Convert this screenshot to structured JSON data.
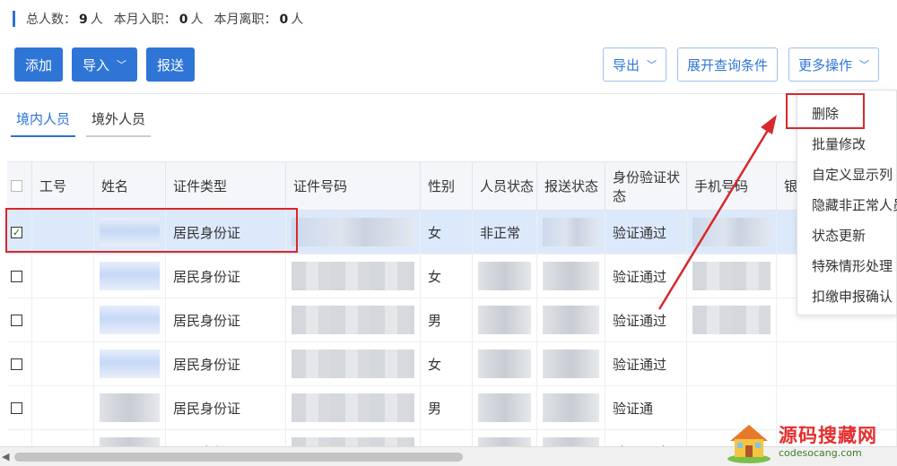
{
  "summary": {
    "total_label": "总人数：",
    "total_value": "9",
    "total_unit": "人",
    "joined_label": "本月入职：",
    "joined_value": "0",
    "joined_unit": "人",
    "left_label": "本月离职：",
    "left_value": "0",
    "left_unit": "人"
  },
  "toolbar": {
    "add_label": "添加",
    "import_label": "导入",
    "report_label": "报送",
    "export_label": "导出",
    "expand_query_label": "展开查询条件",
    "more_label": "更多操作"
  },
  "tabs": [
    {
      "label": "境内人员",
      "active": true
    },
    {
      "label": "境外人员",
      "active": false
    }
  ],
  "table": {
    "headers": [
      "工号",
      "姓名",
      "证件类型",
      "证件号码",
      "性别",
      "人员状态",
      "报送状态",
      "身份验证状态",
      "手机号码",
      "银"
    ],
    "rows": [
      {
        "checked": true,
        "id_type": "居民身份证",
        "gender": "女",
        "status": "非正常",
        "verify": "验证通过"
      },
      {
        "checked": false,
        "id_type": "居民身份证",
        "gender": "女",
        "status": "",
        "verify": "验证通过"
      },
      {
        "checked": false,
        "id_type": "居民身份证",
        "gender": "男",
        "status": "",
        "verify": "验证通过"
      },
      {
        "checked": false,
        "id_type": "居民身份证",
        "gender": "女",
        "status": "",
        "verify": "验证通过"
      },
      {
        "checked": false,
        "id_type": "居民身份证",
        "gender": "男",
        "status": "",
        "verify": "验证通"
      },
      {
        "checked": false,
        "id_type": "居民身份证",
        "gender": "",
        "status": "",
        "verify": "验证通过"
      }
    ]
  },
  "more_menu": {
    "items": [
      "删除",
      "批量修改",
      "自定义显示列",
      "隐藏非正常人员",
      "状态更新",
      "特殊情形处理",
      "扣缴申报确认"
    ]
  },
  "watermark": {
    "title": "源码搜藏网",
    "url": "codesocang.com"
  },
  "colors": {
    "primary": "#2f75d6",
    "highlight": "#d8282b",
    "selected_row": "#dce9fb"
  }
}
